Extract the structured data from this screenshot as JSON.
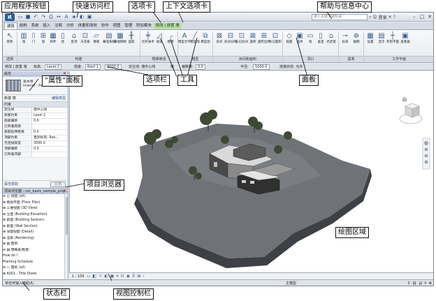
{
  "titlebar": {
    "app_button": "R",
    "qat_icons": [
      "open-icon",
      "save-icon",
      "undo-icon",
      "redo-icon",
      "print-icon",
      "measure-icon",
      "text-icon",
      "3d-view-icon",
      "section-icon",
      "close-hidden-icon"
    ],
    "search_placeholder": "键入关键字或短语",
    "help": {
      "signin": "登录",
      "help_icon": "?"
    }
  },
  "tabs": [
    {
      "label": "建筑",
      "active": true
    },
    {
      "label": "结构"
    },
    {
      "label": "系统"
    },
    {
      "label": "插入"
    },
    {
      "label": "注释"
    },
    {
      "label": "分析"
    },
    {
      "label": "体量和场地"
    },
    {
      "label": "协作"
    },
    {
      "label": "视图"
    },
    {
      "label": "管理"
    },
    {
      "label": "附加模块"
    },
    {
      "label": "修改 | 放置 墙",
      "ctx": true
    }
  ],
  "ribbon": {
    "tools": [
      "修改",
      "墙",
      "门",
      "窗",
      "构件",
      "柱",
      "屋顶",
      "天花板",
      "楼板",
      "幕墙系统",
      "幕墙网格",
      "竖梃",
      "栏杆扶手",
      "坡道",
      "楼梯",
      "模型文字",
      "模型线",
      "模型组",
      "房间",
      "房间分隔",
      "标记房间",
      "面积",
      "面积边界",
      "标记面积",
      "按面",
      "竖井",
      "墙",
      "垂直",
      "老虎窗",
      "标高",
      "轴网",
      "设置",
      "显示",
      "参照平面",
      "查看器"
    ],
    "panels": [
      "选择",
      "构建",
      "楼梯坡道",
      "模型",
      "房间和面积",
      "洞口",
      "基准",
      "工作平面"
    ]
  },
  "optionsbar": {
    "modify_label": "修改 | 放置 墙",
    "level_label": "标高:",
    "level_value": "Level 2",
    "height_label": "高度:",
    "height_value": "Roof 1",
    "height_num": "8000.0",
    "location_label": "定位线: 墙中心线",
    "chain_label": "链",
    "offset_label": "偏移量:",
    "offset_value": "0.0",
    "radius_label": "半径:",
    "radius_value": "1000.0",
    "join_label": "连接状态: 允许"
  },
  "properties": {
    "title": "属性",
    "type_name": "基本墙",
    "type_sub": "Interior - Partition",
    "filter": "新建 墙",
    "edit_type": "编辑类型",
    "group": "约束",
    "rows": [
      {
        "k": "定位线",
        "v": "墙中心线"
      },
      {
        "k": "底部约束",
        "v": "Level 2"
      },
      {
        "k": "底部偏移",
        "v": "0.0"
      },
      {
        "k": "已附着底部",
        "v": ""
      },
      {
        "k": "底部延伸距离",
        "v": "0.0"
      },
      {
        "k": "顶部约束",
        "v": "直到标高: Roo..."
      },
      {
        "k": "无连接高度",
        "v": "3000.0"
      },
      {
        "k": "顶部偏移",
        "v": "0.0"
      },
      {
        "k": "已附着顶部",
        "v": ""
      }
    ],
    "help_link": "属性帮助",
    "apply": "应用"
  },
  "browser": {
    "title": "项目浏览器 - rac_basic_sample_proj...",
    "items": [
      "⊟ ◫ 视图 (all)",
      "  ⊞ 楼层平面 (Floor Plan)",
      "  ⊞ 三维视图 (3D View)",
      "  ⊞ 立面 (Building Elevation)",
      "  ⊞ 剖面 (Building Section)",
      "  ⊞ 剖面 (Wall Section)",
      "  ⊞ 详图视图 (Detail)",
      "  ⊞ 渲染 (Rendering)",
      "⊞ ▤ 图例",
      "⊟ ▤ 明细表/数量",
      "    How do I",
      "    Planting Schedule",
      "⊟ ▭ 图纸 (all)",
      "  ⊞ A001 - Title Sheet",
      "  ⊞ A101 - Site Plan"
    ]
  },
  "viewcontrol": {
    "scale": "1 : 100",
    "icons": [
      "detail-level-icon",
      "visual-style-icon",
      "sun-path-icon",
      "shadows-icon",
      "render-icon",
      "crop-icon",
      "show-crop-icon",
      "temp-hide-icon",
      "reveal-hidden-icon",
      "analytical-icon",
      "highlight-icon"
    ]
  },
  "statusbar": {
    "text": "单击可输入墙起点。",
    "model": "主模型"
  },
  "annotations": {
    "app_button": "应用程序按钮",
    "qat": "快速访问栏",
    "tab": "选项卡",
    "context_tab": "上下文选项卡",
    "help_center": "帮助与信息中心",
    "properties_panel": "“属性”面板",
    "options_bar": "选项栏",
    "tools": "工具",
    "panel": "面板",
    "project_browser": "项目浏览器",
    "drawing_area": "绘图区域",
    "status_bar": "状态栏",
    "view_control_bar": "视图控制栏"
  },
  "colors": {
    "ribbon": "#eef0f3",
    "context_tab": "#b9dfa9",
    "accent": "#2f5d9a"
  }
}
